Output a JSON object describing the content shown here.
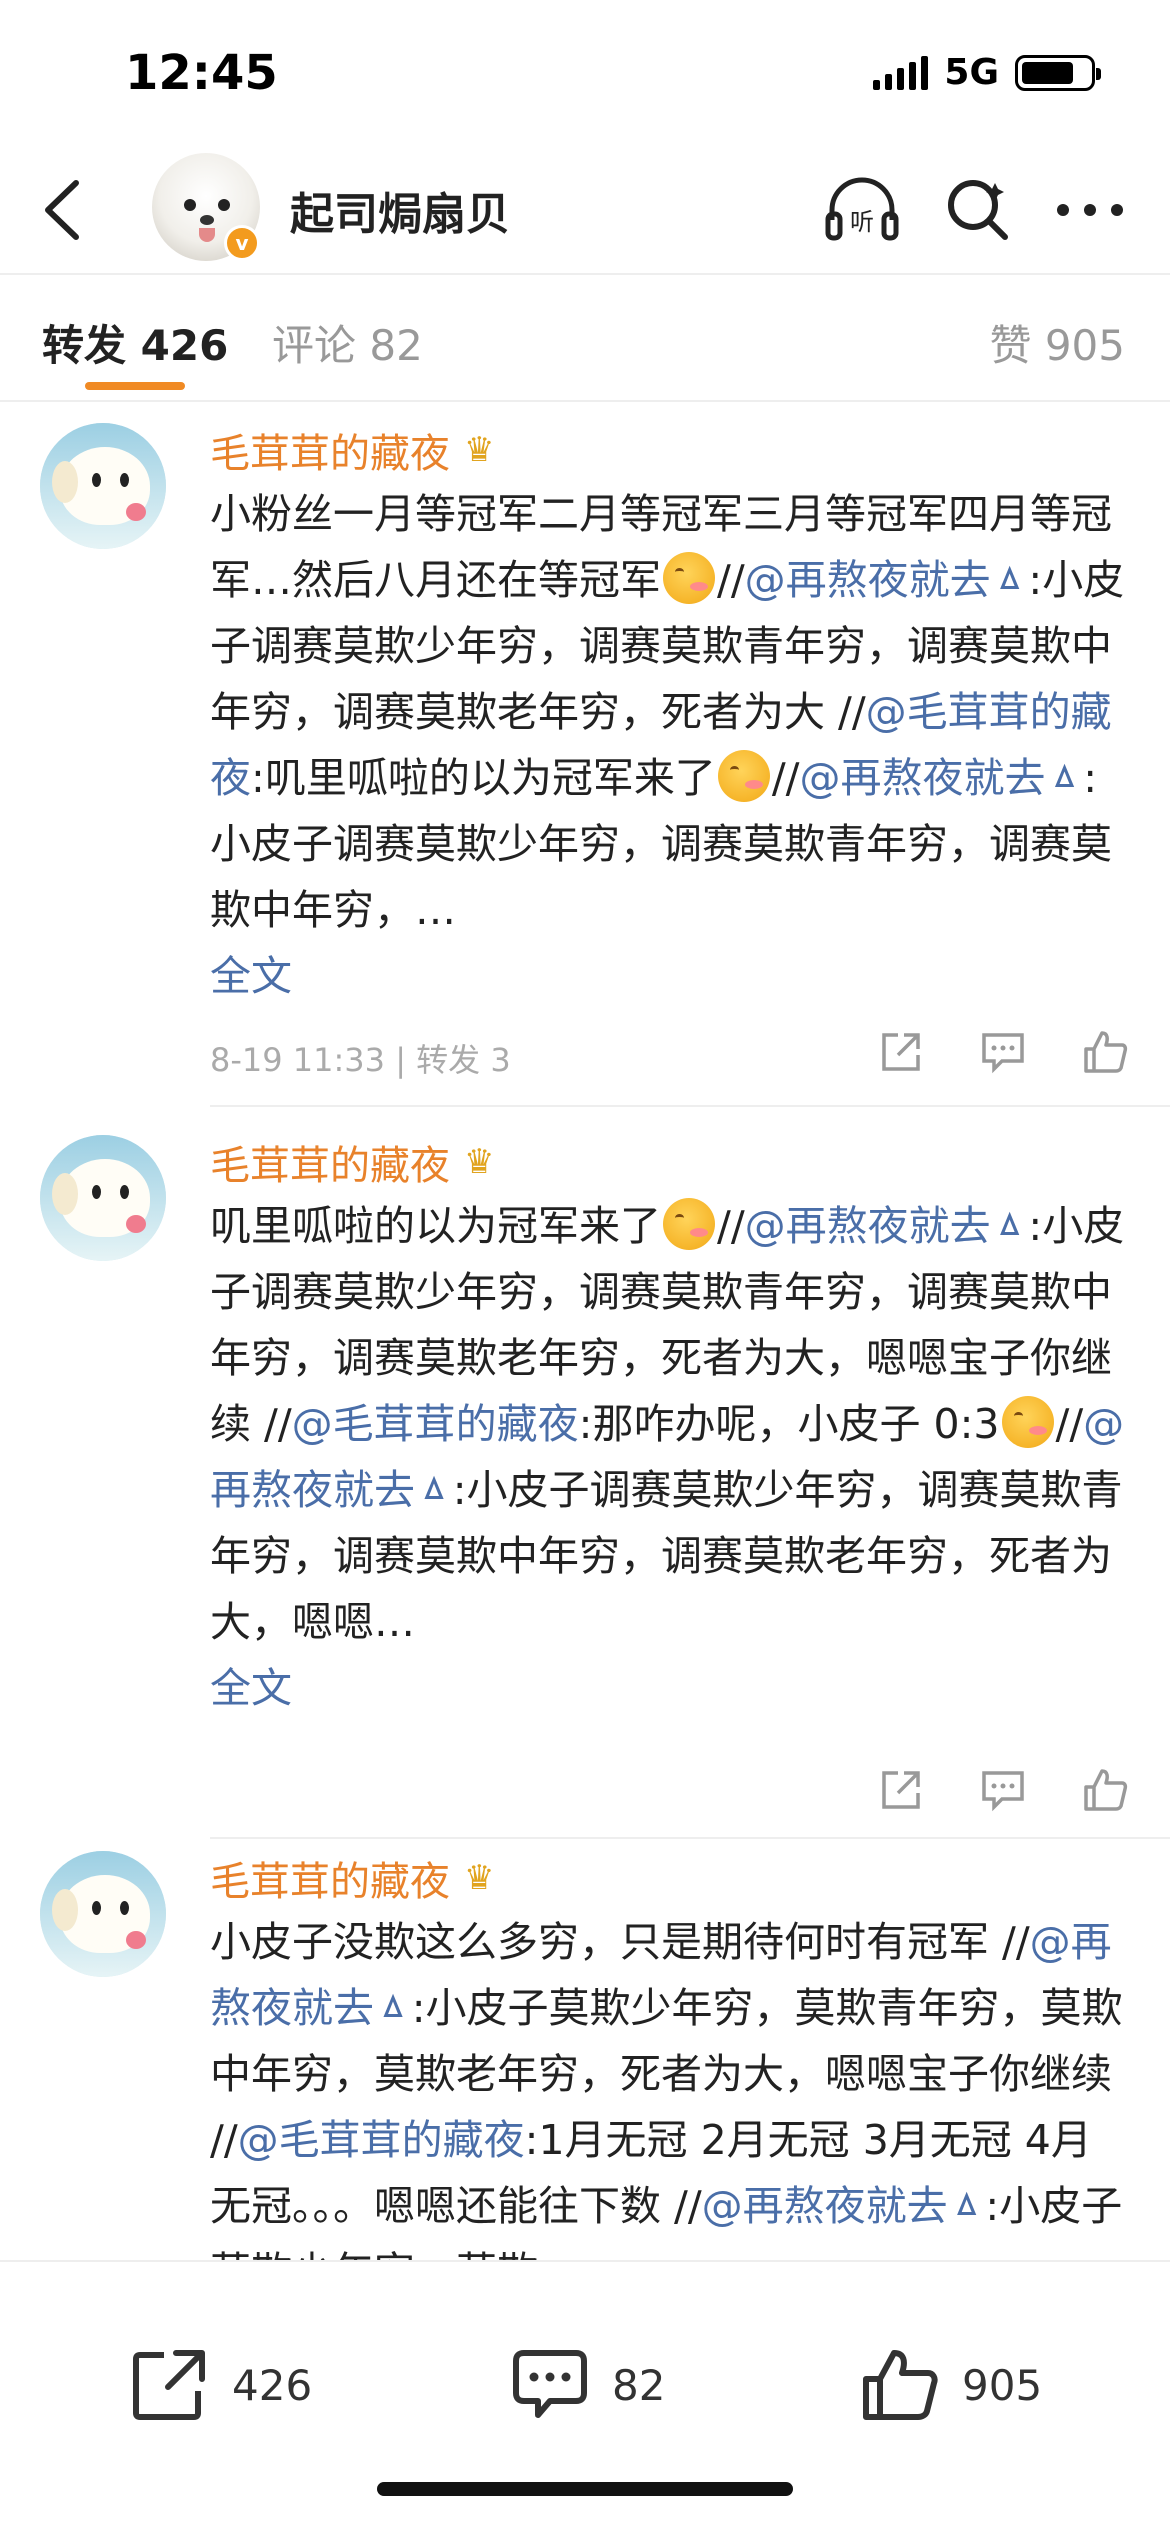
{
  "status_bar": {
    "time": "12:45",
    "network": "5G"
  },
  "header": {
    "username": "起司焗扇贝",
    "verified_badge": "v"
  },
  "tabs": {
    "repost": "转发 426",
    "comment": "评论 82",
    "like": "赞 905"
  },
  "posts": [
    {
      "author": "毛茸茸的藏夜",
      "segments": [
        "小粉丝一月等冠军二月等冠军三月等冠军四月等冠军…然后八月还在等冠军",
        "//",
        "@再熬夜就去ㅿ",
        ":小皮子调赛莫欺少年穷，调赛莫欺青年穷，调赛莫欺中年穷，调赛莫欺老年穷，死者为大 //",
        "@毛茸茸的藏夜",
        ":叽里呱啦的以为冠军来了",
        "//",
        "@再熬夜就去ㅿ",
        ":小皮子调赛莫欺少年穷，调赛莫欺青年穷，调赛莫欺中年穷，…"
      ],
      "full_text_label": "全文",
      "meta": "8-19 11:33 | 转发 3"
    },
    {
      "author": "毛茸茸的藏夜",
      "segments": [
        "叽里呱啦的以为冠军来了",
        "//",
        "@再熬夜就去ㅿ",
        ":小皮子调赛莫欺少年穷，调赛莫欺青年穷，调赛莫欺中年穷，调赛莫欺老年穷，死者为大，嗯嗯宝子你继续 //",
        "@毛茸茸的藏夜",
        ":那咋办呢，小皮子 0:3",
        "//",
        "@再熬夜就去ㅿ",
        ":小皮子调赛莫欺少年穷，调赛莫欺青年穷，调赛莫欺中年穷，调赛莫欺老年穷，死者为大，嗯嗯…"
      ],
      "full_text_label": "全文"
    },
    {
      "author": "毛茸茸的藏夜",
      "segments": [
        "小皮子没欺这么多穷，只是期待何时有冠军 //",
        "@再熬夜就去ㅿ",
        ":小皮子莫欺少年穷，莫欺青年穷，莫欺中年穷，莫欺老年穷，死者为大，嗯嗯宝子你继续 //",
        "@毛茸茸的藏夜",
        ":1月无冠 2月无冠 3月无冠 4月无冠。。。嗯嗯还能往下数 //",
        "@再熬夜就去ㅿ",
        ":小皮子莫欺少年穷，莫欺"
      ]
    }
  ],
  "bottom_bar": {
    "repost_count": "426",
    "comment_count": "82",
    "like_count": "905"
  },
  "colors": {
    "accent": "#f08a24",
    "author": "#e8822b",
    "mention": "#4a6ea8"
  }
}
